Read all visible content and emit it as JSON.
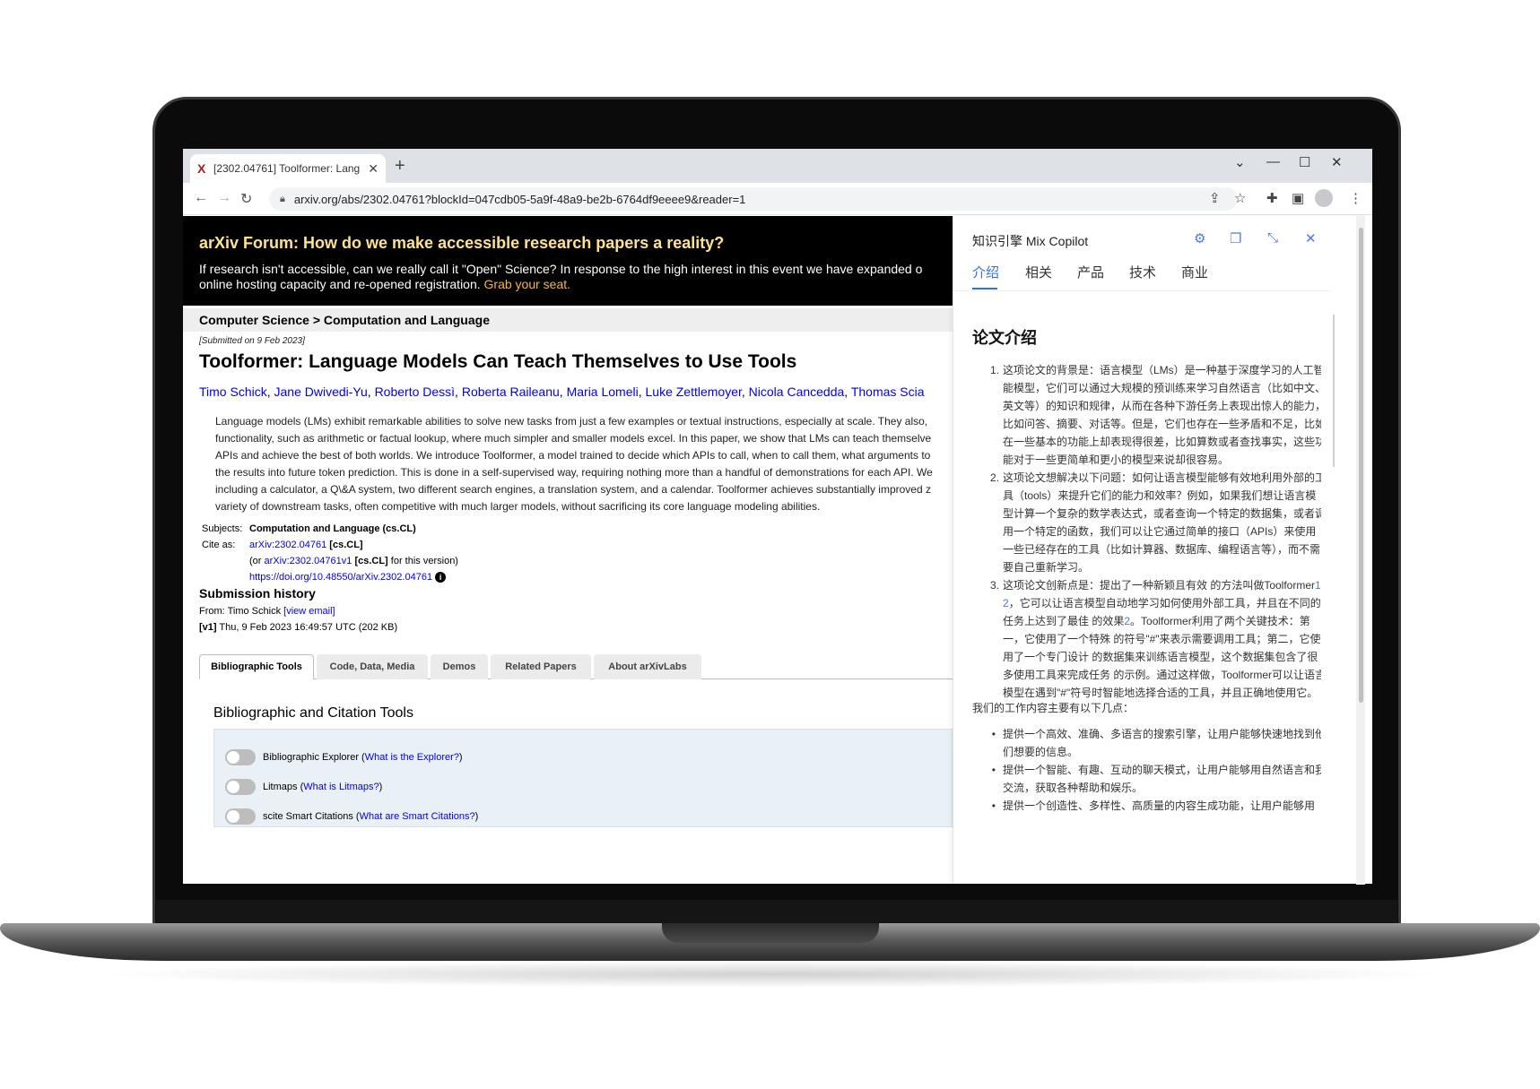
{
  "browser": {
    "tab_title": "[2302.04761] Toolformer: Lang",
    "tab_favicon": "X",
    "new_tab": "+",
    "url": "arxiv.org/abs/2302.04761?blockId=047cdb05-5a9f-48a9-be2b-6764df9eeee9&reader=1"
  },
  "banner": {
    "title": "arXiv Forum: How do we make accessible research papers a reality?",
    "body": "If research isn't accessible, can we really call it \"Open\" Science? In response to the high interest in this event we have expanded o",
    "body2": "online hosting capacity and re-opened registration.",
    "link": "Grab your seat."
  },
  "breadcrumb": "Computer Science > Computation and Language",
  "paper": {
    "submitted": "[Submitted on 9 Feb 2023]",
    "title": "Toolformer: Language Models Can Teach Themselves to Use Tools",
    "authors": [
      "Timo Schick",
      "Jane Dwivedi-Yu",
      "Roberto Dessì",
      "Roberta Raileanu",
      "Maria Lomeli",
      "Luke Zettlemoyer",
      "Nicola Cancedda",
      "Thomas Scia"
    ],
    "abstract_lines": [
      "Language models (LMs) exhibit remarkable abilities to solve new tasks from just a few examples or textual instructions, especially at scale. They also,",
      "functionality, such as arithmetic or factual lookup, where much simpler and smaller models excel. In this paper, we show that LMs can teach themselve",
      "APIs and achieve the best of both worlds. We introduce Toolformer, a model trained to decide which APIs to call, when to call them, what arguments to",
      "the results into future token prediction. This is done in a self-supervised way, requiring nothing more than a handful of demonstrations for each API. We",
      "including a calculator, a Q\\&A system, two different search engines, a translation system, and a calendar. Toolformer achieves substantially improved z",
      "variety of downstream tasks, often competitive with much larger models, without sacrificing its core language modeling abilities."
    ],
    "subjects_label": "Subjects:",
    "subjects_value": "Computation and Language (cs.CL)",
    "cite_label": "Cite as:",
    "cite_link": "arXiv:2302.04761",
    "cite_tag": "[cs.CL]",
    "cite_or": "(or",
    "cite_link_v1": "arXiv:2302.04761v1",
    "cite_tag_v1": "[cs.CL]",
    "cite_version": "for this version)",
    "doi": "https://doi.org/10.48550/arXiv.2302.04761",
    "history_title": "Submission history",
    "from_text": "From: Timo Schick",
    "view_email": "[view email]",
    "v1_tag": "[v1]",
    "v1_text": "Thu, 9 Feb 2023 16:49:57 UTC (202 KB)"
  },
  "tool_tabs": [
    "Bibliographic Tools",
    "Code, Data, Media",
    "Demos",
    "Related Papers",
    "About arXivLabs"
  ],
  "biblio": {
    "heading": "Bibliographic and Citation Tools",
    "items": [
      {
        "label": "Bibliographic Explorer (",
        "link": "What is the Explorer?",
        "end": ")"
      },
      {
        "label": "Litmaps (",
        "link": "What is Litmaps?",
        "end": ")"
      },
      {
        "label": "scite Smart Citations (",
        "link": "What are Smart Citations?",
        "end": ")"
      }
    ]
  },
  "copilot": {
    "title": "知识引擎 Mix Copilot",
    "tabs": [
      "介绍",
      "相关",
      "产品",
      "技术",
      "商业"
    ],
    "heading": "论文介绍",
    "points": [
      {
        "num": "1.",
        "text": "这项论文的背景是：语言模型（LMs）是一种基于深度学习的人工智能模型，它们可以通过大规模的预训练来学习自然语言（比如中文、英文等）的知识和规律，从而在各种下游任务上表现出惊人的能力，比如问答、摘要、对话等。但是，它们也存在一些矛盾和不足，比如在一些基本的功能上却表现得很差，比如算数或者查找事实，这些功能对于一些更简单和更小的模型来说却很容易。"
      },
      {
        "num": "2.",
        "text": "这项论文想解决以下问题：如何让语言模型能够有效地利用外部的工具（tools）来提升它们的能力和效率？例如，如果我们想让语言模型计算一个复杂的数学表达式，或者查询一个特定的数据集，或者调用一个特定的函数，我们可以让它通过简单的接口（APIs）来使用一些已经存在的工具（比如计算器、数据库、编程语言等），而不需要自己重新学习。"
      },
      {
        "num": "3.",
        "text_a": "这项论文创新点是：提出了一种新颖且有效 的方法叫做Toolformer",
        "ref1": "1 2",
        "text_b": "，它可以让语言模型自动地学习如何使用外部工具，并且在不同的任务上达到了最佳 的效果",
        "ref2": "2",
        "text_c": "。Toolformer利用了两个关键技术：第一，它使用了一个特殊 的符号\"#\"来表示需要调用工具；第二，它使用了一个专门设计 的数据集来训练语言模型，这个数据集包含了很多使用工具来完成任务 的示例。通过这样做，Toolformer可以让语言模型在遇到\"#\"符号时智能地选择合适的工具，并且正确地使用它。"
      }
    ],
    "intro": "我们的工作内容主要有以下几点：",
    "bullets": [
      "提供一个高效、准确、多语言的搜索引擎，让用户能够快速地找到他们想要的信息。",
      "提供一个智能、有趣、互动的聊天模式，让用户能够用自然语言和我交流，获取各种帮助和娱乐。",
      "提供一个创造性、多样性、高质量的内容生成功能，让用户能够用"
    ]
  }
}
